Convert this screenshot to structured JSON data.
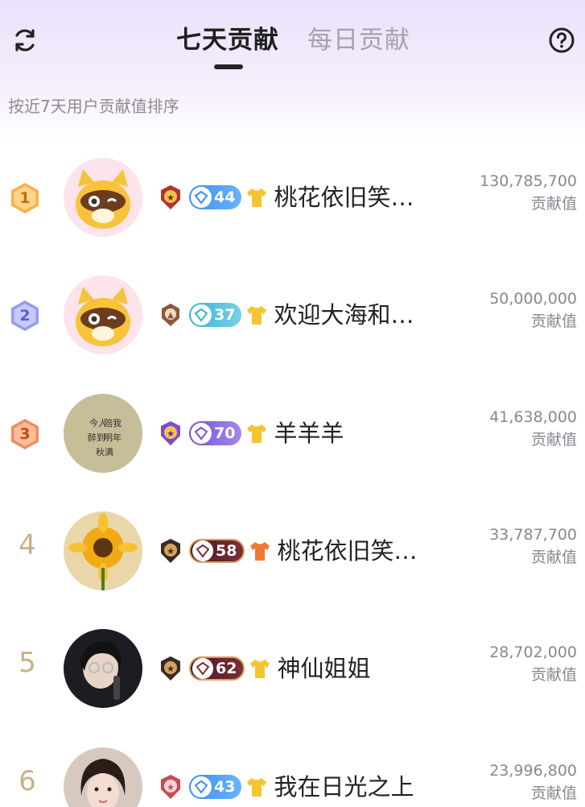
{
  "header": {
    "tabs": [
      {
        "label": "七天贡献",
        "active": true
      },
      {
        "label": "每日贡献",
        "active": false
      }
    ],
    "refresh_icon": "refresh-icon",
    "help_icon": "help-circle-icon"
  },
  "subtitle": "按近7天用户贡献值排序",
  "score_label": "贡献值",
  "colors": {
    "rank1": "#f4a641",
    "rank2": "#8a8ff1",
    "rank3": "#f08a5a",
    "plain_rank": "#c9b083"
  },
  "rows": [
    {
      "rank": "1",
      "level": "44",
      "name": "桃花依旧笑…",
      "score": "130,785,700"
    },
    {
      "rank": "2",
      "level": "37",
      "name": "欢迎大海和…",
      "score": "50,000,000"
    },
    {
      "rank": "3",
      "level": "70",
      "name": "羊羊羊",
      "score": "41,638,000"
    },
    {
      "rank": "4",
      "level": "58",
      "name": "桃花依旧笑…",
      "score": "33,787,700"
    },
    {
      "rank": "5",
      "level": "62",
      "name": "神仙姐姐",
      "score": "28,702,000"
    },
    {
      "rank": "6",
      "level": "43",
      "name": "我在日光之上",
      "score": "23,996,800"
    }
  ]
}
